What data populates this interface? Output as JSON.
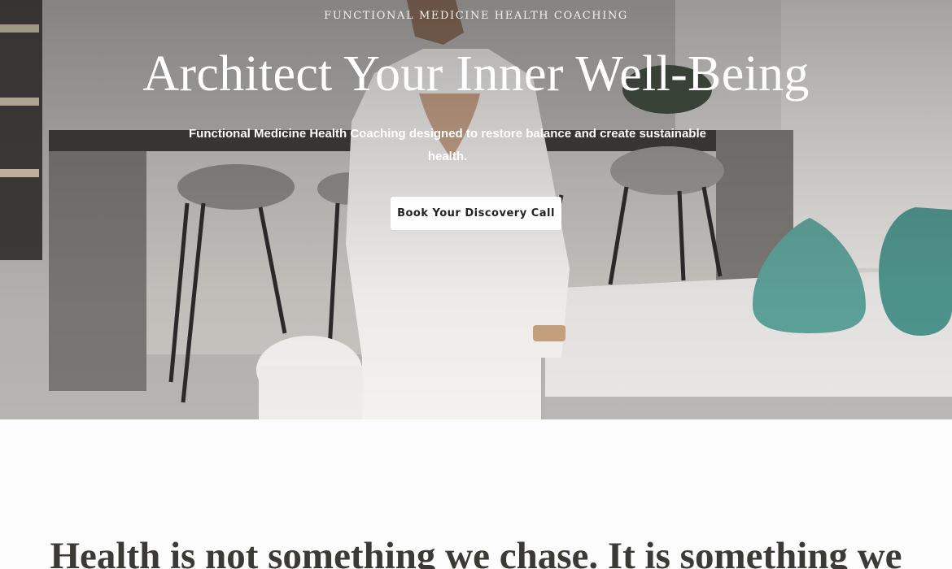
{
  "hero": {
    "eyebrow": "FUNCTIONAL MEDICINE HEALTH COACHING",
    "title": "Architect Your Inner Well-Being",
    "subtitle": "Functional Medicine Health Coaching designed to restore balance and create sustainable health.",
    "cta_label": "Book Your Discovery Call"
  },
  "section": {
    "quote": "Health is not something we chase. It is something we"
  },
  "colors": {
    "hero_text": "#ffffff",
    "cta_background": "#ffffff",
    "cta_text": "#222222",
    "vase": "#5fa39a",
    "quote_text": "#3c3a37"
  },
  "icons": {
    "hero_image": "woman-in-white-vest-interior-photo"
  }
}
